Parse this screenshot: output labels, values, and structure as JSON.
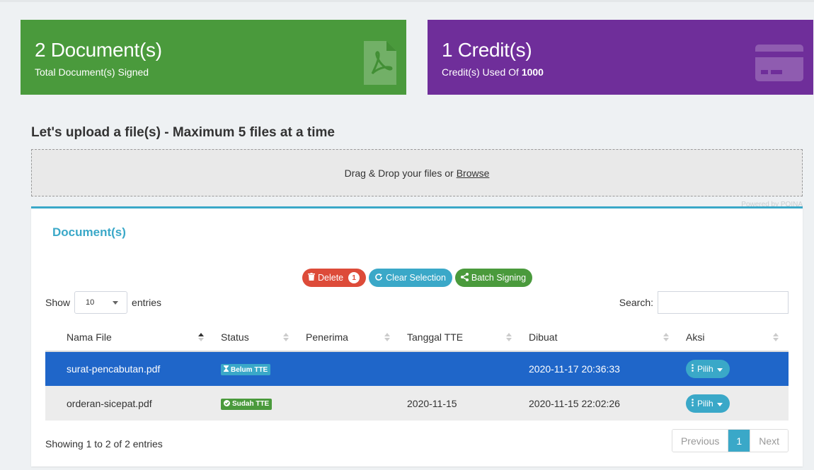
{
  "stats": {
    "documents": {
      "value": "2 Document(s)",
      "label": "Total Document(s) Signed"
    },
    "credits": {
      "value": "1 Credit(s)",
      "label_prefix": "Credit(s) Used Of",
      "label_total": "1000"
    }
  },
  "upload": {
    "title": "Let's upload a file(s) - Maximum 5 files at a time",
    "drop_text": "Drag & Drop your files or",
    "browse_label": "Browse",
    "powered": "Powered by PQINA"
  },
  "documents": {
    "title": "Document(s)",
    "actions": {
      "delete_label": "Delete",
      "delete_count": "1",
      "clear_label": "Clear Selection",
      "batch_label": "Batch Signing"
    },
    "show_label": "Show",
    "page_length": "10",
    "entries_label": "entries",
    "search_label": "Search:",
    "columns": [
      "Nama File",
      "Status",
      "Penerima",
      "Tanggal TTE",
      "Dibuat",
      "Aksi"
    ],
    "rows": [
      {
        "file": "surat-pencabutan.pdf",
        "status": "Belum TTE",
        "penerima": "",
        "tanggal_tte": "",
        "dibuat": "2020-11-17 20:36:33",
        "aksi": "Pilih"
      },
      {
        "file": "orderan-sicepat.pdf",
        "status": "Sudah TTE",
        "penerima": "",
        "tanggal_tte": "2020-11-15",
        "dibuat": "2020-11-15 22:02:26",
        "aksi": "Pilih"
      }
    ],
    "info": "Showing 1 to 2 of 2 entries",
    "pagination": {
      "previous": "Previous",
      "current": "1",
      "next": "Next"
    }
  },
  "colors": {
    "green": "#4a9a3c",
    "purple": "#6f2e9a",
    "accent": "#3aa8c8",
    "selected_row": "#1f66c9",
    "danger": "#dd4b39"
  }
}
